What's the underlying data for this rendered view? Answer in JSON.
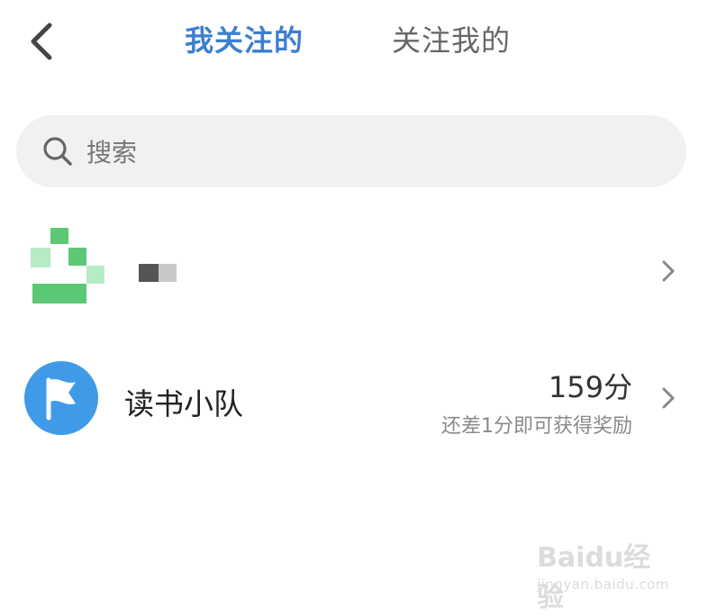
{
  "header": {
    "tabs": [
      {
        "label": "我关注的",
        "active": true
      },
      {
        "label": "关注我的",
        "active": false
      }
    ]
  },
  "search": {
    "placeholder": "搜索"
  },
  "list": [
    {
      "type": "user",
      "name": "",
      "avatar_blurred": true
    },
    {
      "type": "team",
      "name": "读书小队",
      "score": "159分",
      "hint": "还差1分即可获得奖励"
    }
  ],
  "watermark": {
    "brand": "Baidu经验",
    "url": "jingyan.baidu.com"
  },
  "colors": {
    "accent": "#3d7fd0",
    "team_avatar": "#3f9be8",
    "search_bg": "#f1f1f3"
  },
  "icons": {
    "back": "chevron-left-icon",
    "search": "search-icon",
    "row": "chevron-right-icon",
    "team": "flag-icon"
  }
}
